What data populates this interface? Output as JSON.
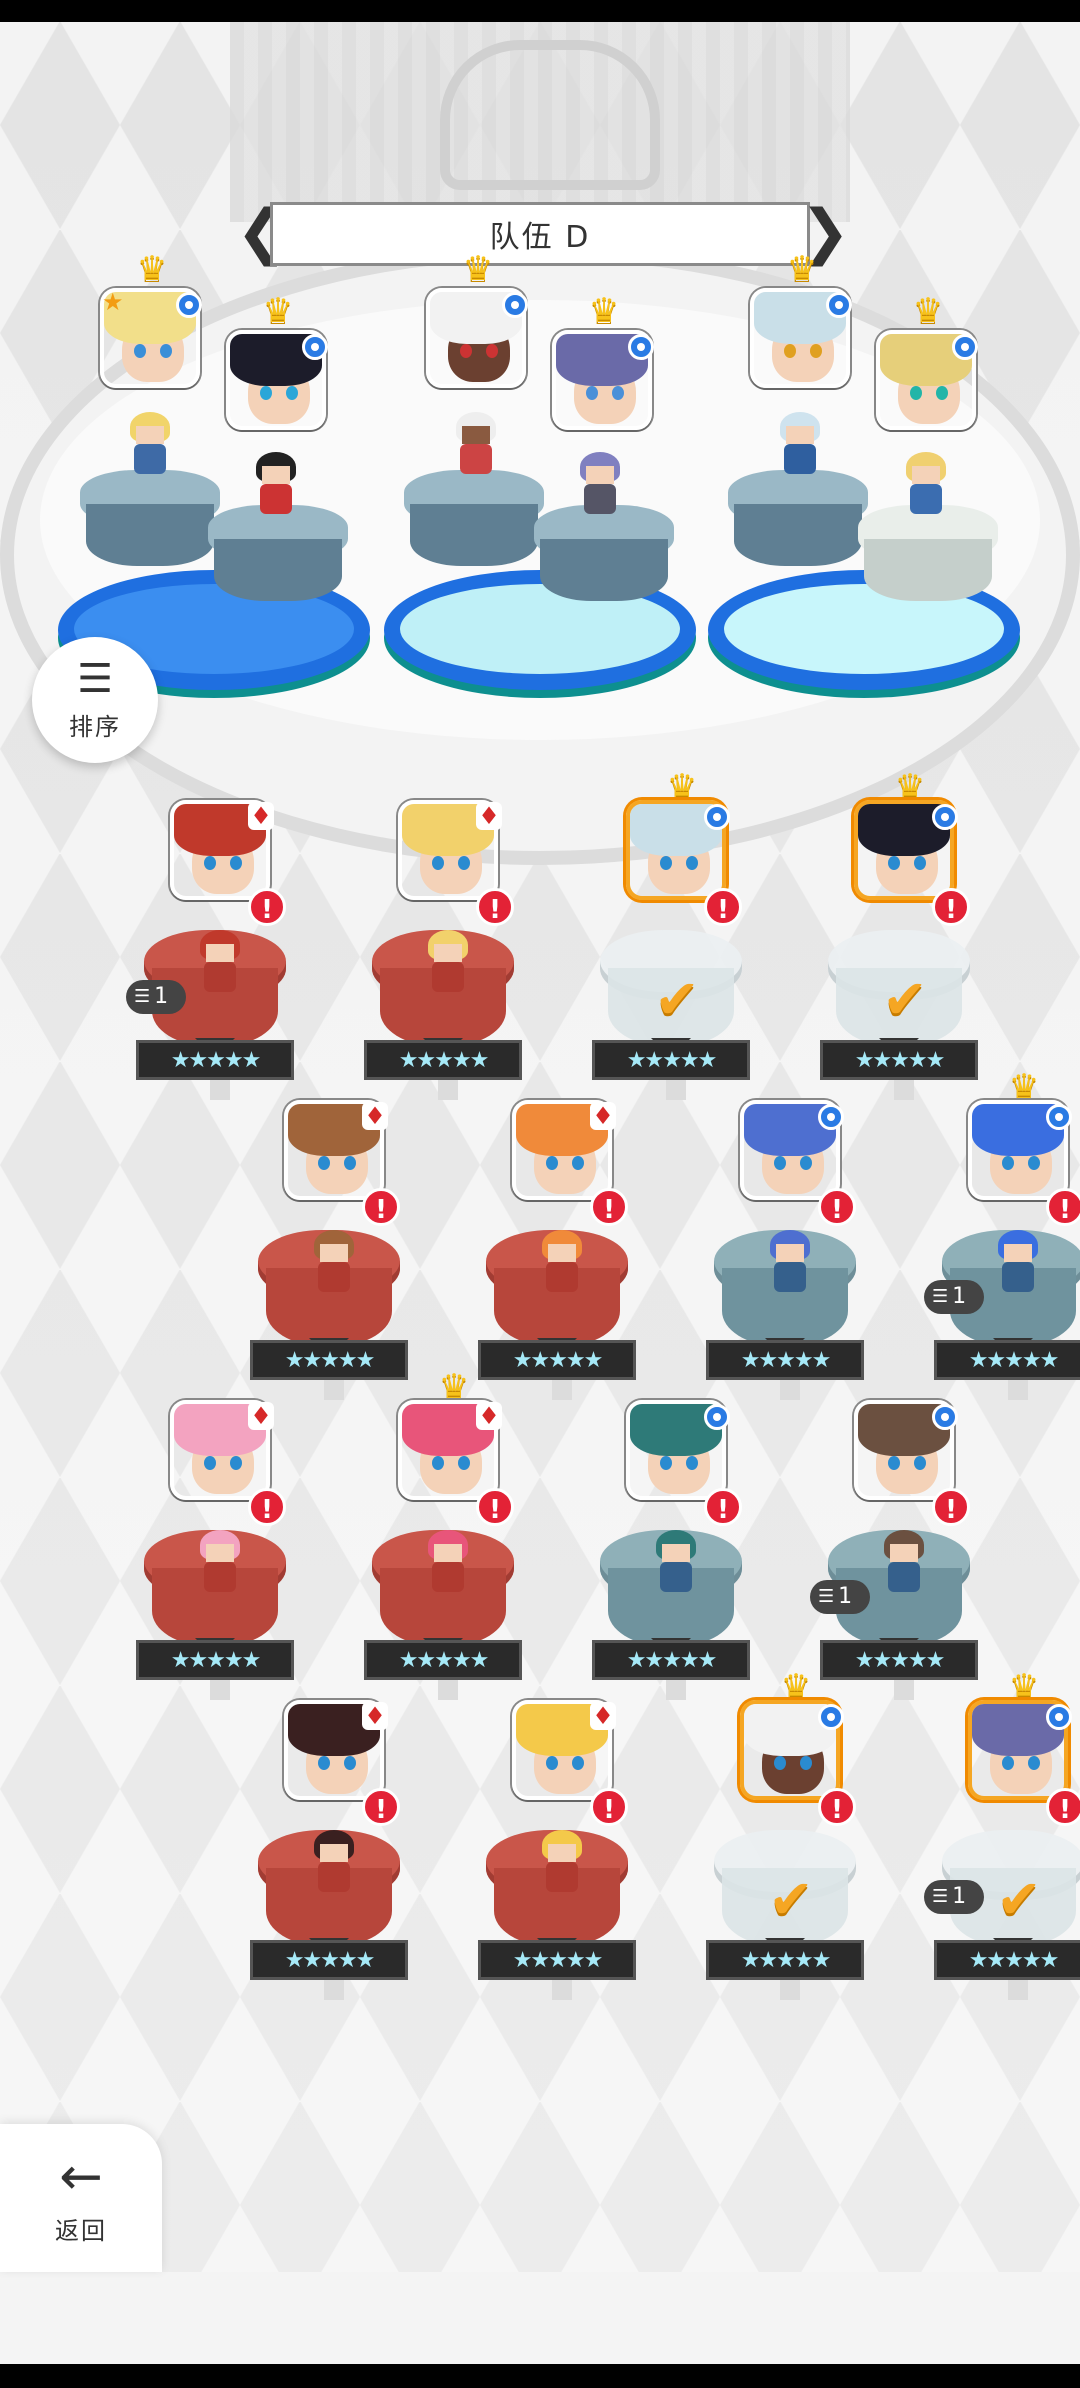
{
  "header": {
    "team_name": "队伍 D",
    "prev_arrow": "❮",
    "next_arrow": "❯"
  },
  "buttons": {
    "sort_label": "排序",
    "sort_icon": "sort-icon",
    "back_label": "返回",
    "back_icon": "arrow-left-icon"
  },
  "symbols": {
    "alert": "!",
    "crown": "♛",
    "red_element": "♦",
    "check": "✔",
    "stars": "★★★★★",
    "lead_star": "★"
  },
  "team_slots": [
    {
      "slot": 1,
      "hero": "blonde-knight",
      "leader": true,
      "crown": true,
      "element": "blue"
    },
    {
      "slot": 2,
      "hero": "black-hair-girl",
      "crown": true,
      "element": "blue"
    },
    {
      "slot": 3,
      "hero": "white-hair-dark-skin",
      "crown": true,
      "element": "blue"
    },
    {
      "slot": 4,
      "hero": "purple-hair-girl",
      "crown": true,
      "element": "blue"
    },
    {
      "slot": 5,
      "hero": "silver-hair-girl",
      "crown": true,
      "element": "blue"
    },
    {
      "slot": 6,
      "hero": "blonde-teal-eyes",
      "crown": true,
      "element": "blue"
    }
  ],
  "roster": [
    {
      "hero": "pirate-redhead",
      "element": "red",
      "alert": true,
      "stars": 5,
      "count": "1"
    },
    {
      "hero": "blonde-helmet",
      "element": "red",
      "alert": true,
      "stars": 5
    },
    {
      "hero": "silver-hair-girl",
      "element": "blue",
      "alert": true,
      "selected": true,
      "crown": true,
      "stars": 5
    },
    {
      "hero": "black-hair-girl",
      "element": "blue",
      "alert": true,
      "selected": true,
      "crown": true,
      "stars": 5
    },
    {
      "hero": "brunette-wink",
      "element": "red",
      "alert": true,
      "stars": 5
    },
    {
      "hero": "orange-hair-wink",
      "element": "red",
      "alert": true,
      "stars": 5
    },
    {
      "hero": "blue-hair-masked",
      "element": "blue",
      "alert": true,
      "stars": 5
    },
    {
      "hero": "blue-hair-cat",
      "element": "blue",
      "alert": true,
      "crown": true,
      "stars": 5,
      "count": "1"
    },
    {
      "hero": "pink-hair-girl",
      "element": "red",
      "alert": true,
      "stars": 5
    },
    {
      "hero": "pink-hair-crowned",
      "element": "red",
      "alert": true,
      "crown": true,
      "stars": 5
    },
    {
      "hero": "teal-hair-boy",
      "element": "blue",
      "alert": true,
      "stars": 5
    },
    {
      "hero": "brown-hair-nun",
      "element": "blue",
      "alert": true,
      "stars": 5,
      "count": "1"
    },
    {
      "hero": "dark-hair-lady",
      "element": "red",
      "alert": true,
      "stars": 5
    },
    {
      "hero": "blonde-cat-girl",
      "element": "red",
      "alert": true,
      "stars": 5
    },
    {
      "hero": "white-hair-dark-skin",
      "element": "blue",
      "alert": true,
      "selected": true,
      "crown": true,
      "stars": 5
    },
    {
      "hero": "purple-hair-girl",
      "element": "blue",
      "alert": true,
      "selected": true,
      "crown": true,
      "stars": 5,
      "count": "1"
    }
  ],
  "colors": {
    "accent_gold": "#f5a623",
    "alert_red": "#e32236",
    "element_blue": "#2a7be4",
    "element_red": "#d62828",
    "pad_blue": "#1f6fe0"
  }
}
